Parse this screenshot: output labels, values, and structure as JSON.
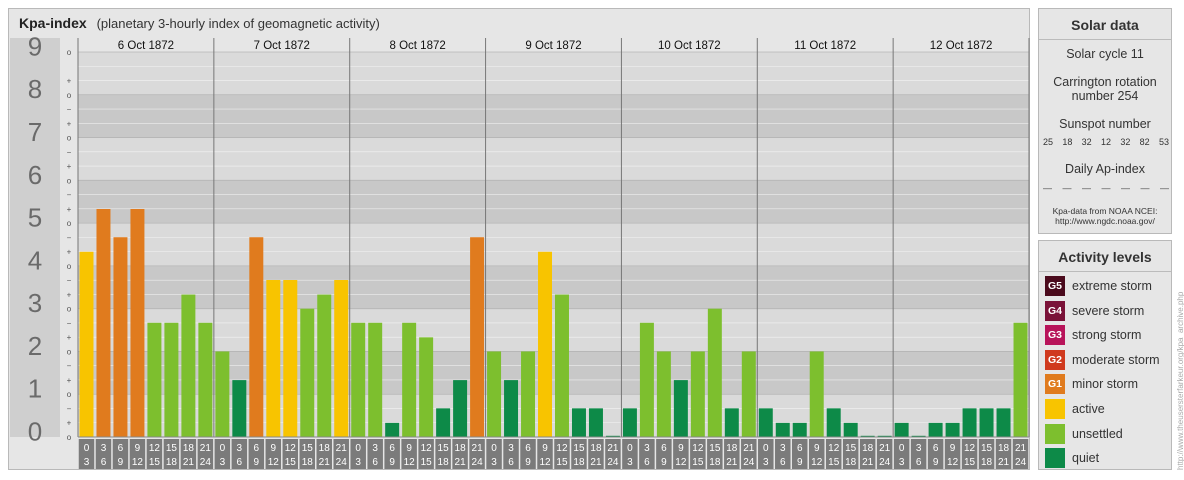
{
  "title": "Kpa-index",
  "subtitle": "(planetary 3-hourly index of geomagnetic activity)",
  "chart_data": {
    "type": "bar",
    "title": "Kpa-index",
    "subtitle": "(planetary 3-hourly index of geomagnetic activity)",
    "ylim": [
      0,
      9
    ],
    "y_ticks": [
      "0",
      "1",
      "2",
      "3",
      "4",
      "5",
      "6",
      "7",
      "8",
      "9"
    ],
    "minor_ticks": [
      "o",
      "+"
    ],
    "minor_ticks_mid": [
      "−",
      "o",
      "+"
    ],
    "days": [
      "6 Oct 1872",
      "7 Oct 1872",
      "8 Oct 1872",
      "9 Oct 1872",
      "10 Oct 1872",
      "11 Oct 1872",
      "12 Oct 1872"
    ],
    "hour_top": [
      "0",
      "3",
      "6",
      "9",
      "12",
      "15",
      "18",
      "21"
    ],
    "hour_bottom": [
      "3",
      "6",
      "9",
      "12",
      "15",
      "18",
      "21",
      "24"
    ],
    "values": [
      [
        4.33,
        5.33,
        4.67,
        5.33,
        2.67,
        2.67,
        3.33,
        2.67
      ],
      [
        2.0,
        1.33,
        4.67,
        3.67,
        3.67,
        3.0,
        3.33,
        3.67
      ],
      [
        2.67,
        2.67,
        0.33,
        2.67,
        2.33,
        0.67,
        1.33,
        4.67
      ],
      [
        2.0,
        1.33,
        2.0,
        4.33,
        3.33,
        0.67,
        0.67,
        0.0
      ],
      [
        0.67,
        2.67,
        2.0,
        1.33,
        2.0,
        3.0,
        0.67,
        2.0
      ],
      [
        0.67,
        0.33,
        0.33,
        2.0,
        0.67,
        0.33,
        0.0,
        0.0
      ],
      [
        0.33,
        0.0,
        0.33,
        0.33,
        0.67,
        0.67,
        0.67,
        2.67
      ]
    ]
  },
  "colors": {
    "g5": "#4a0a1c",
    "g4": "#7a1238",
    "g3": "#b8145a",
    "g2": "#d03a1e",
    "g1": "#e07b1e",
    "active": "#f8c400",
    "unsettled": "#7dbf2e",
    "quiet": "#0d8a48"
  },
  "solar": {
    "title": "Solar data",
    "cycle": "Solar cycle 11",
    "carrington_line1": "Carrington rotation",
    "carrington_line2": "number 254",
    "sunspot_label": "Sunspot number",
    "sunspot_values": [
      "25",
      "18",
      "32",
      "12",
      "32",
      "82",
      "53"
    ],
    "ap_label": "Daily Ap-index",
    "ap_values": [
      "—",
      "—",
      "—",
      "—",
      "—",
      "—",
      "—"
    ],
    "credit_line1": "Kpa-data from NOAA NCEI:",
    "credit_line2": "http://www.ngdc.noaa.gov/"
  },
  "activity": {
    "title": "Activity levels",
    "items": [
      {
        "code": "G5",
        "label": "extreme storm",
        "color": "#4a0a1c"
      },
      {
        "code": "G4",
        "label": "severe storm",
        "color": "#7a1238"
      },
      {
        "code": "G3",
        "label": "strong storm",
        "color": "#b8145a"
      },
      {
        "code": "G2",
        "label": "moderate storm",
        "color": "#d03a1e"
      },
      {
        "code": "G1",
        "label": "minor storm",
        "color": "#e07b1e"
      },
      {
        "code": "",
        "label": "active",
        "color": "#f8c400"
      },
      {
        "code": "",
        "label": "unsettled",
        "color": "#7dbf2e"
      },
      {
        "code": "",
        "label": "quiet",
        "color": "#0d8a48"
      }
    ]
  },
  "credit": "http://www.theusersterfarkeur.org/kpa_archive.php"
}
